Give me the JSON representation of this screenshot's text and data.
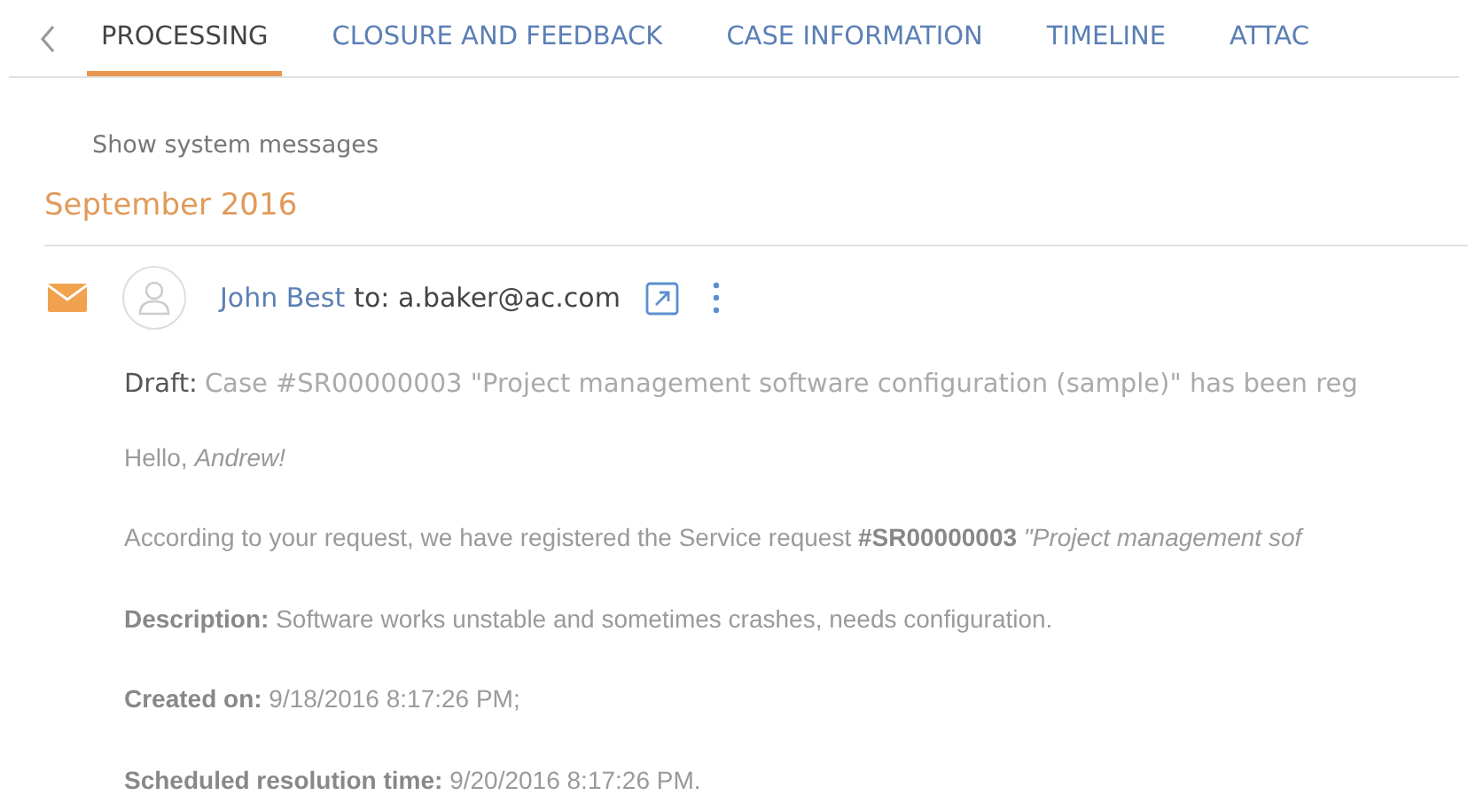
{
  "tabs": [
    {
      "label": "PROCESSING",
      "selected": true
    },
    {
      "label": "CLOSURE AND FEEDBACK",
      "selected": false
    },
    {
      "label": "CASE INFORMATION",
      "selected": false
    },
    {
      "label": "TIMELINE",
      "selected": false
    },
    {
      "label": "ATTAC",
      "selected": false
    }
  ],
  "show_system_messages": "Show system messages",
  "month_heading": "September 2016",
  "email": {
    "sender": "John Best",
    "recipient": "to: a.baker@ac.com",
    "draft_label": "Draft:",
    "subject": "Case #SR00000003 \"Project management software configuration (sample)\" has been reg",
    "body": [
      "Hello, *Andrew!*",
      "According to your request, we have registered the Service request **#SR00000003** *\"Project management sof*",
      "**Description:** Software works unstable and sometimes crashes, needs configuration.",
      "**Created on:** 9/18/2016 8:17:26 PM;",
      "**Scheduled resolution time:** 9/20/2016 8:17:26 PM."
    ]
  }
}
